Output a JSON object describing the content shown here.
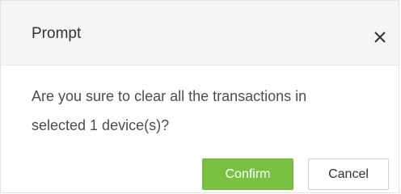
{
  "dialog": {
    "title": "Prompt",
    "message_line1": "Are you sure to clear all the transactions in",
    "message_line2": "selected 1 device(s)?",
    "close_icon": "close-icon",
    "confirm_label": "Confirm",
    "cancel_label": "Cancel"
  },
  "colors": {
    "confirm_bg": "#7ac143",
    "header_bg": "#f4f4f4"
  }
}
